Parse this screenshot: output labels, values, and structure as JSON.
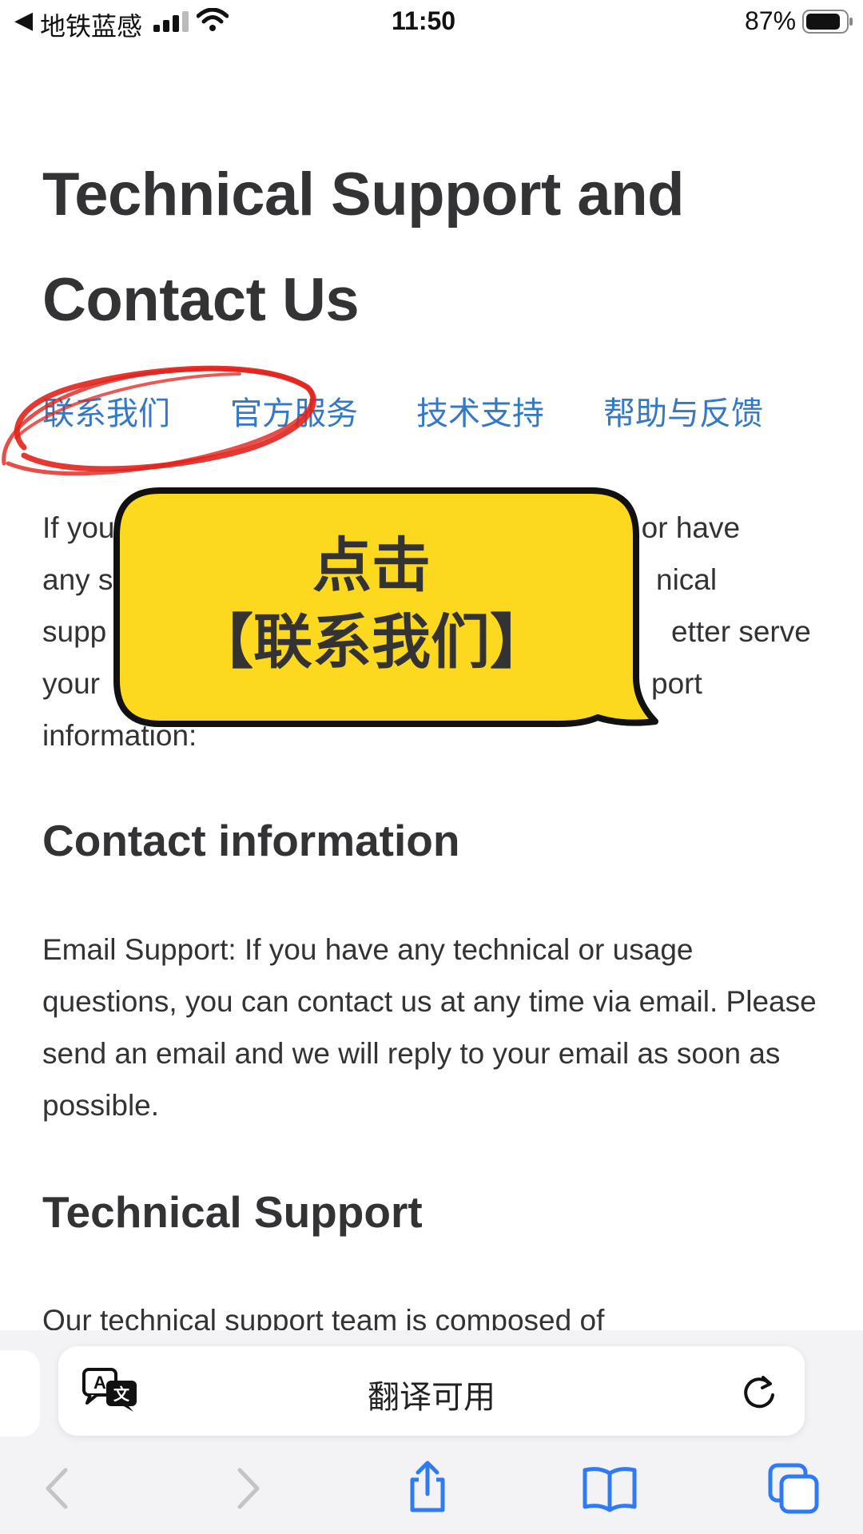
{
  "status_bar": {
    "back_glyph": "◀",
    "carrier": "地铁蓝感",
    "time": "11:50",
    "battery_percent": "87%",
    "battery_level": 0.87,
    "icons": [
      "signal-icon",
      "wifi-icon",
      "battery-icon"
    ]
  },
  "page": {
    "title": "Technical Support and Contact Us",
    "nav_links": [
      "联系我们",
      "官方服务",
      "技术支持",
      "帮助与反馈"
    ],
    "intro_fragments": {
      "line1_left": "If you",
      "line1_right": "se, or have",
      "line2_left": "any s",
      "line2_right": "nical",
      "line3_left": "supp",
      "line3_right": "etter serve",
      "line4_left": "your",
      "line4_right": "port",
      "line5": "information:"
    },
    "sections": [
      {
        "heading": "Contact information",
        "body": "Email Support: If you have any technical or usage questions, you can contact us at any time via email. Please send an email and we will reply to your email as soon as possible."
      },
      {
        "heading": "Technical Support",
        "body": "Our technical support team is composed of"
      }
    ]
  },
  "annotation": {
    "bubble_line1": "点击",
    "bubble_line2": "【联系我们】",
    "bubble_color": "#fcd81e",
    "circle_color": "#e0231c"
  },
  "browser": {
    "address_label": "翻译可用",
    "icons": [
      "translate-icon",
      "reload-icon",
      "back-icon",
      "forward-icon",
      "share-icon",
      "bookmarks-icon",
      "tabs-icon"
    ],
    "accent_color": "#3478c6"
  }
}
